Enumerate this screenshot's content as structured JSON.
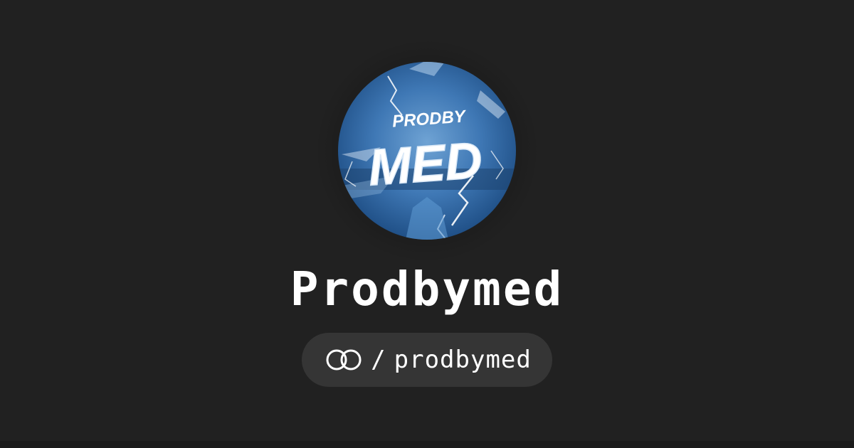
{
  "profile": {
    "name": "Prodbymed",
    "avatar": {
      "icon": "prodbymed-avatar",
      "top_text": "PRODBY",
      "main_text": "MED"
    }
  },
  "handle": {
    "logo_icon": "interlocked-rings-icon",
    "separator": "/",
    "username": "prodbymed"
  },
  "colors": {
    "background": "#212121",
    "pill": "#353535",
    "text": "#ffffff",
    "avatar_blue": "#3f78b5"
  }
}
